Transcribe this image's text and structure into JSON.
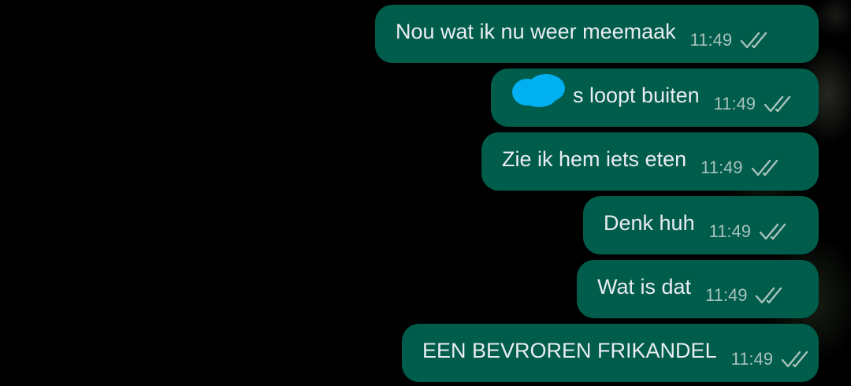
{
  "messages": [
    {
      "text": "Nou wat ik nu weer meemaak",
      "time": "11:49",
      "status_icon": "double-check-icon"
    },
    {
      "text": "s loopt buiten",
      "time": "11:49",
      "status_icon": "double-check-icon",
      "redacted_prefix": true
    },
    {
      "text": "Zie ik hem iets eten",
      "time": "11:49",
      "status_icon": "double-check-icon"
    },
    {
      "text": "Denk huh",
      "time": "11:49",
      "status_icon": "double-check-icon"
    },
    {
      "text": "Wat is dat",
      "time": "11:49",
      "status_icon": "double-check-icon"
    },
    {
      "text": "EEN BEVROREN FRIKANDEL",
      "time": "11:49",
      "status_icon": "double-check-icon"
    }
  ],
  "colors": {
    "background": "#000000",
    "bubble_outgoing": "#005c4b",
    "bubble_text": "#e9edef",
    "timestamp": "#a7c2bb",
    "redaction": "#00b0f0"
  }
}
